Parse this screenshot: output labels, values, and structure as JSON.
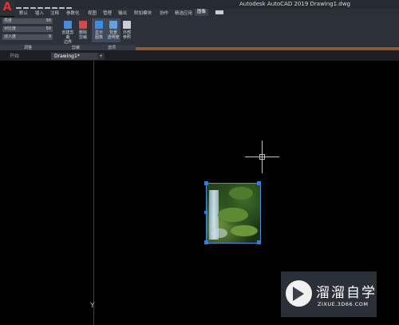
{
  "app": {
    "title": "Autodesk AutoCAD 2019    Drawing1.dwg",
    "app_button_letter": "A"
  },
  "ribbon_tabs": [
    "默认",
    "插入",
    "注释",
    "参数化",
    "视图",
    "管理",
    "输出",
    "附加模块",
    "协作",
    "精选应用",
    "图像"
  ],
  "ribbon": {
    "adjust": {
      "brightness": {
        "label": "亮度",
        "value": "50"
      },
      "contrast": {
        "label": "对比度",
        "value": "50"
      },
      "fade": {
        "label": "淡入度",
        "value": "0"
      }
    },
    "buttons": [
      {
        "label": "创建剪裁\n边界",
        "icon": "clip-boundary-icon",
        "color": "#4a8ad8"
      },
      {
        "label": "删除\n剪裁",
        "icon": "remove-clip-icon",
        "color": "#d04a4a"
      },
      {
        "label": "显示\n图像",
        "icon": "show-image-icon",
        "color": "#3b8ee0"
      },
      {
        "label": "背景\n透明度",
        "icon": "background-transparency-icon",
        "color": "#6aa0d8"
      },
      {
        "label": "外部\n参照",
        "icon": "external-reference-icon",
        "color": "#c9ced6"
      }
    ],
    "panel_labels": {
      "adjust": "调整",
      "clip": "剪裁",
      "options": "选项"
    }
  },
  "doc_tabs": {
    "start": "开始",
    "drawing": "Drawing1*",
    "add": "+"
  },
  "ucs_label": "Y",
  "watermark": {
    "brand": "溜溜自学",
    "url": "ZIXUE.3D66.COM"
  }
}
